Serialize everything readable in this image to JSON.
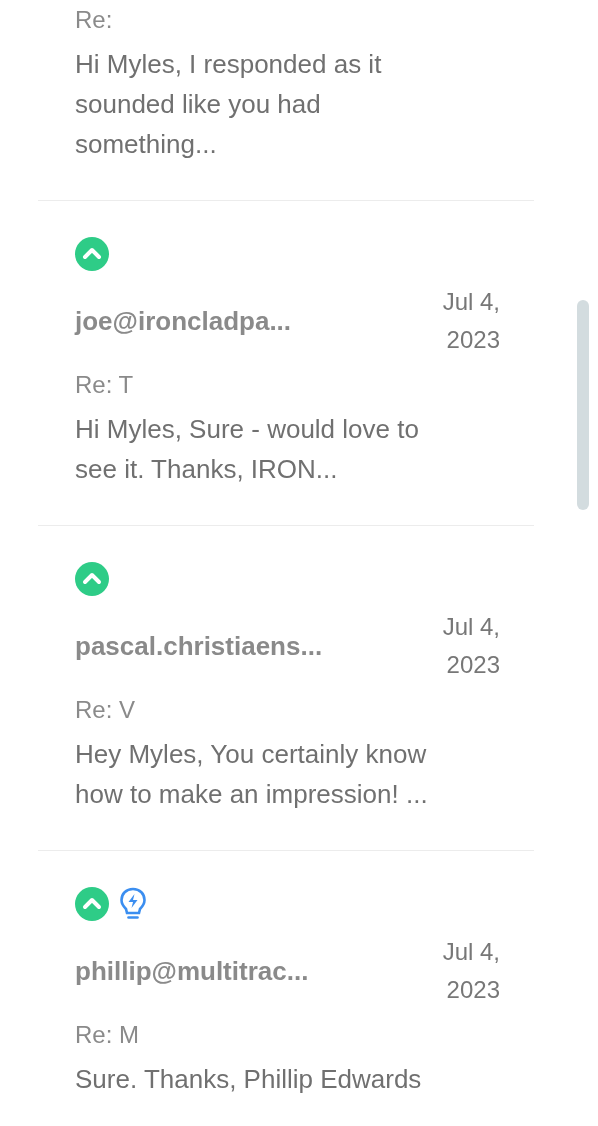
{
  "messages": [
    {
      "subject": "Re:",
      "preview": "Hi Myles, I responded as it sounded like you had something..."
    },
    {
      "icons": [
        {
          "kind": "upvote"
        }
      ],
      "sender": "joe@ironcladpa...",
      "date": "Jul 4, 2023",
      "subject": "Re: T",
      "preview": "Hi Myles, Sure - would love to see it. Thanks, IRON..."
    },
    {
      "icons": [
        {
          "kind": "upvote"
        }
      ],
      "sender": "pascal.christiaens...",
      "date": "Jul 4, 2023",
      "subject": "Re: V",
      "preview": "Hey Myles,  You certainly know how to make an impression! ..."
    },
    {
      "icons": [
        {
          "kind": "upvote"
        },
        {
          "kind": "bulb"
        }
      ],
      "sender": "phillip@multitrac...",
      "date": "Jul 4, 2023",
      "subject": "Re: M",
      "preview": "Sure. Thanks, Phillip Edwards"
    }
  ]
}
